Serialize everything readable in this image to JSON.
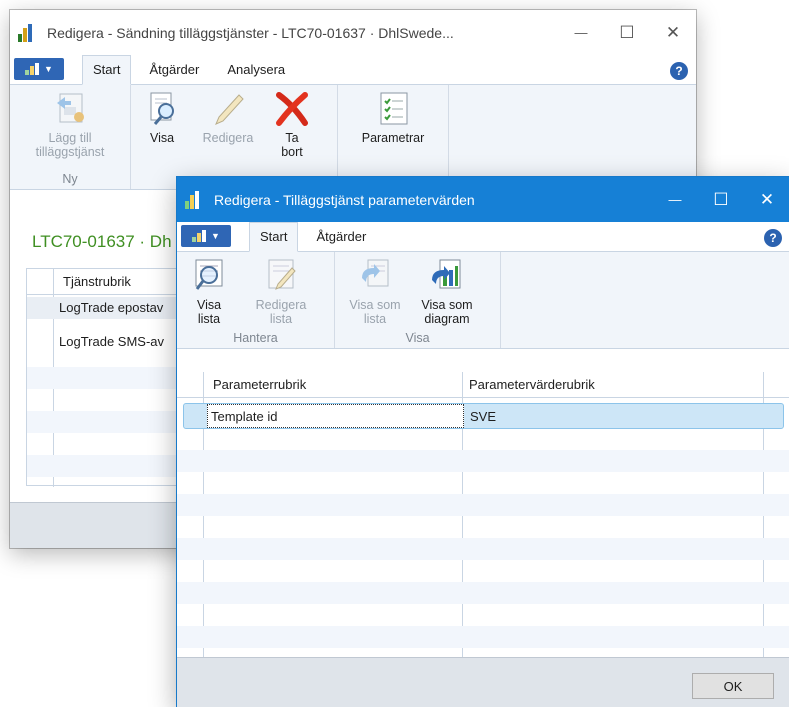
{
  "back_window": {
    "title": "Redigera - Sändning tilläggstjänster - LTC70-01637 · DhlSwede...",
    "tabs": [
      "Start",
      "Åtgärder",
      "Analysera"
    ],
    "ribbon": {
      "add_service": "Lägg till tilläggstjänst",
      "group_new": "Ny",
      "view": "Visa",
      "edit": "Redigera",
      "delete": "Ta bort",
      "parameters": "Parametrar"
    },
    "subtitle": "LTC70-01637 · Dh",
    "column_header": "Tjänstrubrik",
    "rows": [
      "LogTrade epostav",
      "LogTrade SMS-av"
    ]
  },
  "front_window": {
    "title": "Redigera - Tilläggstjänst parametervärden",
    "tabs": [
      "Start",
      "Åtgärder"
    ],
    "ribbon": {
      "show_list": "Visa lista",
      "edit_list": "Redigera lista",
      "group_manage": "Hantera",
      "show_as_list": "Visa som lista",
      "show_as_chart": "Visa som diagram",
      "group_view": "Visa"
    },
    "columns": [
      "Parameterrubrik",
      "Parametervärderubrik"
    ],
    "rows": [
      {
        "param": "Template id",
        "value": "SVE"
      }
    ],
    "ok": "OK"
  },
  "window_controls": {
    "minimize": "—",
    "maximize": "☐",
    "close": "✕"
  },
  "colors": {
    "titlebar_active": "#1680d6",
    "selected_row": "#cde6f7",
    "ribbon_bg": "#f1f5fa"
  }
}
